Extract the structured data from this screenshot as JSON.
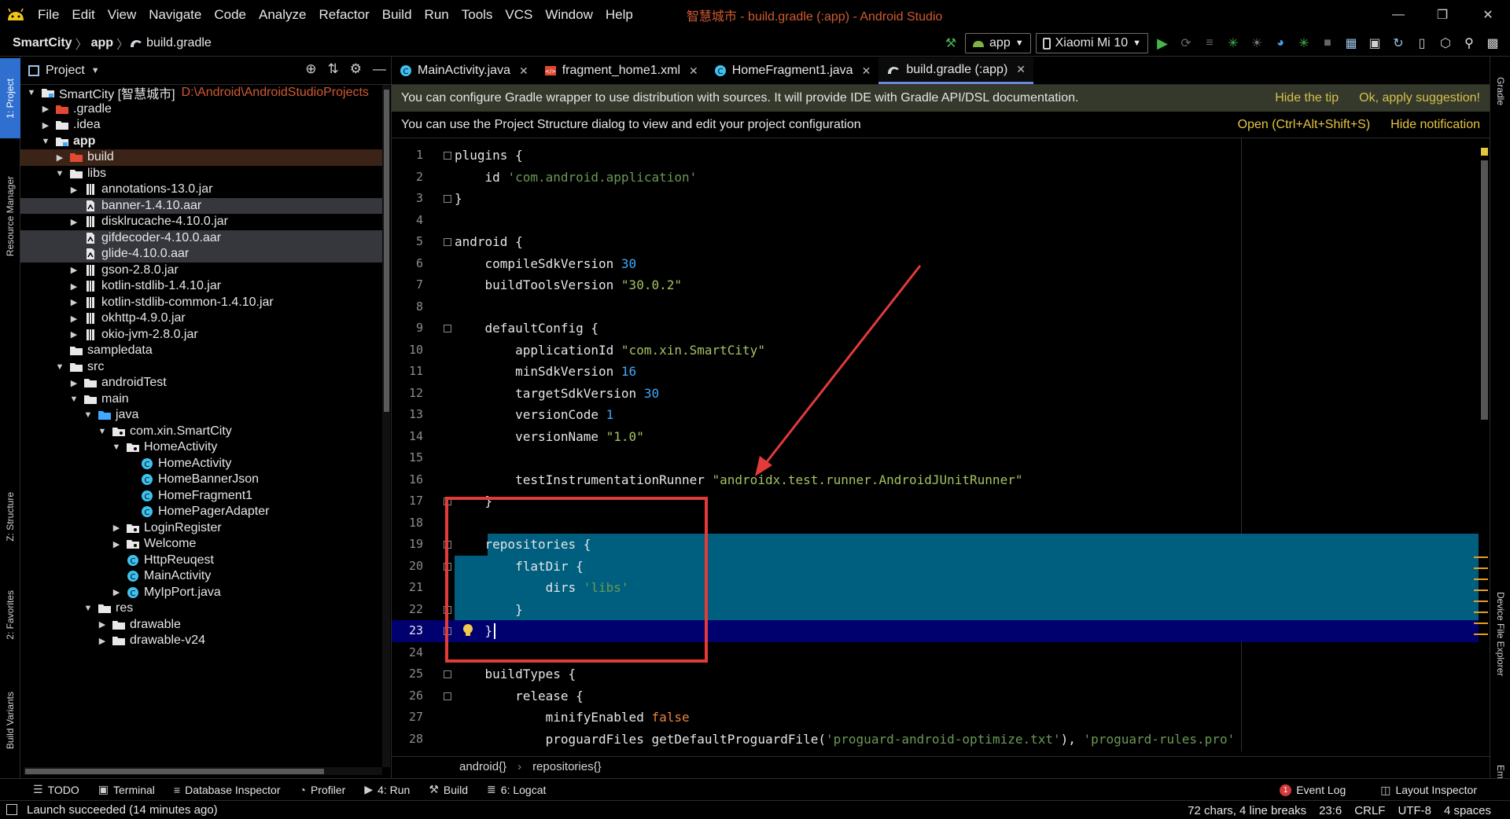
{
  "window": {
    "title": "智慧城市 - build.gradle (:app) - Android Studio",
    "menu": [
      "File",
      "Edit",
      "View",
      "Navigate",
      "Code",
      "Analyze",
      "Refactor",
      "Build",
      "Run",
      "Tools",
      "VCS",
      "Window",
      "Help"
    ]
  },
  "nav": {
    "crumbs": [
      "SmartCity",
      "app",
      "build.gradle"
    ],
    "run_config": "app",
    "device": "Xiaomi Mi 10"
  },
  "left_strip": {
    "tabs": [
      "1: Project",
      "Resource Manager",
      "Z: Structure",
      "2: Favorites",
      "Build Variants"
    ]
  },
  "right_strip": {
    "tabs": [
      "Gradle",
      "Device File Explorer",
      "Emulator"
    ]
  },
  "project": {
    "header": "Project",
    "tree": [
      {
        "label": "SmartCity [智慧城市]",
        "path": "D:\\Android\\AndroidStudioProjects",
        "depth": 0,
        "arrow": "open",
        "icon": "module"
      },
      {
        "label": ".gradle",
        "depth": 1,
        "arrow": "closed",
        "icon": "folder-orange"
      },
      {
        "label": ".idea",
        "depth": 1,
        "arrow": "closed",
        "icon": "folder"
      },
      {
        "label": "app",
        "depth": 1,
        "arrow": "open",
        "icon": "module",
        "bold": true
      },
      {
        "label": "build",
        "depth": 2,
        "arrow": "closed",
        "icon": "folder-orange",
        "state": "build"
      },
      {
        "label": "libs",
        "depth": 2,
        "arrow": "open",
        "icon": "folder"
      },
      {
        "label": "annotations-13.0.jar",
        "depth": 3,
        "arrow": "closed",
        "icon": "jar"
      },
      {
        "label": "banner-1.4.10.aar",
        "depth": 3,
        "arrow": "",
        "icon": "file",
        "state": "sel"
      },
      {
        "label": "disklrucache-4.10.0.jar",
        "depth": 3,
        "arrow": "closed",
        "icon": "jar"
      },
      {
        "label": "gifdecoder-4.10.0.aar",
        "depth": 3,
        "arrow": "",
        "icon": "file",
        "state": "sel"
      },
      {
        "label": "glide-4.10.0.aar",
        "depth": 3,
        "arrow": "",
        "icon": "file",
        "state": "sel"
      },
      {
        "label": "gson-2.8.0.jar",
        "depth": 3,
        "arrow": "closed",
        "icon": "jar"
      },
      {
        "label": "kotlin-stdlib-1.4.10.jar",
        "depth": 3,
        "arrow": "closed",
        "icon": "jar"
      },
      {
        "label": "kotlin-stdlib-common-1.4.10.jar",
        "depth": 3,
        "arrow": "closed",
        "icon": "jar"
      },
      {
        "label": "okhttp-4.9.0.jar",
        "depth": 3,
        "arrow": "closed",
        "icon": "jar"
      },
      {
        "label": "okio-jvm-2.8.0.jar",
        "depth": 3,
        "arrow": "closed",
        "icon": "jar"
      },
      {
        "label": "sampledata",
        "depth": 2,
        "arrow": "",
        "icon": "folder"
      },
      {
        "label": "src",
        "depth": 2,
        "arrow": "open",
        "icon": "folder"
      },
      {
        "label": "androidTest",
        "depth": 3,
        "arrow": "closed",
        "icon": "folder"
      },
      {
        "label": "main",
        "depth": 3,
        "arrow": "open",
        "icon": "folder"
      },
      {
        "label": "java",
        "depth": 4,
        "arrow": "open",
        "icon": "folder-blue"
      },
      {
        "label": "com.xin.SmartCity",
        "depth": 5,
        "arrow": "open",
        "icon": "package"
      },
      {
        "label": "HomeActivity",
        "depth": 6,
        "arrow": "open",
        "icon": "package"
      },
      {
        "label": "HomeActivity",
        "depth": 7,
        "arrow": "",
        "icon": "class"
      },
      {
        "label": "HomeBannerJson",
        "depth": 7,
        "arrow": "",
        "icon": "class"
      },
      {
        "label": "HomeFragment1",
        "depth": 7,
        "arrow": "",
        "icon": "class"
      },
      {
        "label": "HomePagerAdapter",
        "depth": 7,
        "arrow": "",
        "icon": "class"
      },
      {
        "label": "LoginRegister",
        "depth": 6,
        "arrow": "closed",
        "icon": "package"
      },
      {
        "label": "Welcome",
        "depth": 6,
        "arrow": "closed",
        "icon": "package"
      },
      {
        "label": "HttpReuqest",
        "depth": 6,
        "arrow": "",
        "icon": "class"
      },
      {
        "label": "MainActivity",
        "depth": 6,
        "arrow": "",
        "icon": "class"
      },
      {
        "label": "MyIpPort.java",
        "depth": 6,
        "arrow": "closed",
        "icon": "class"
      },
      {
        "label": "res",
        "depth": 4,
        "arrow": "open",
        "icon": "folder"
      },
      {
        "label": "drawable",
        "depth": 5,
        "arrow": "closed",
        "icon": "folder"
      },
      {
        "label": "drawable-v24",
        "depth": 5,
        "arrow": "closed",
        "icon": "folder"
      }
    ]
  },
  "tabs": [
    {
      "label": "MainActivity.java",
      "icon": "class"
    },
    {
      "label": "fragment_home1.xml",
      "icon": "xml"
    },
    {
      "label": "HomeFragment1.java",
      "icon": "class"
    },
    {
      "label": "build.gradle (:app)",
      "icon": "gradle",
      "active": true
    }
  ],
  "notices": [
    {
      "text": "You can configure Gradle wrapper to use distribution with sources. It will provide IDE with Gradle API/DSL documentation.",
      "actions": [
        "Hide the tip",
        "Ok, apply suggestion!"
      ]
    },
    {
      "text": "You can use the Project Structure dialog to view and edit your project configuration",
      "actions": [
        "Open (Ctrl+Alt+Shift+S)",
        "Hide notification"
      ]
    }
  ],
  "code": [
    [
      {
        "t": "plugins {",
        "c": "kw"
      }
    ],
    [
      {
        "t": "    id ",
        "c": "kw"
      },
      {
        "t": "'com.android.application'",
        "c": "str"
      }
    ],
    [
      {
        "t": "}",
        "c": "kw"
      }
    ],
    [],
    [
      {
        "t": "android {",
        "c": "kw"
      }
    ],
    [
      {
        "t": "    compileSdkVersion ",
        "c": "kw"
      },
      {
        "t": "30",
        "c": "num"
      }
    ],
    [
      {
        "t": "    buildToolsVersion ",
        "c": "kw"
      },
      {
        "t": "\"30.0.2\"",
        "c": "str2"
      }
    ],
    [],
    [
      {
        "t": "    defaultConfig {",
        "c": "kw"
      }
    ],
    [
      {
        "t": "        applicationId ",
        "c": "kw"
      },
      {
        "t": "\"com.xin.SmartCity\"",
        "c": "str2"
      }
    ],
    [
      {
        "t": "        minSdkVersion ",
        "c": "kw"
      },
      {
        "t": "16",
        "c": "num"
      }
    ],
    [
      {
        "t": "        targetSdkVersion ",
        "c": "kw"
      },
      {
        "t": "30",
        "c": "num"
      }
    ],
    [
      {
        "t": "        versionCode ",
        "c": "kw"
      },
      {
        "t": "1",
        "c": "num"
      }
    ],
    [
      {
        "t": "        versionName ",
        "c": "kw"
      },
      {
        "t": "\"1.0\"",
        "c": "str2"
      }
    ],
    [],
    [
      {
        "t": "        testInstrumentationRunner ",
        "c": "kw"
      },
      {
        "t": "\"androidx.test.runner.AndroidJUnitRunner\"",
        "c": "str2"
      }
    ],
    [
      {
        "t": "    }",
        "c": "kw"
      }
    ],
    [],
    [
      {
        "t": "    repositories {",
        "c": "kw"
      }
    ],
    [
      {
        "t": "        flatDir {",
        "c": "kw"
      }
    ],
    [
      {
        "t": "            dirs ",
        "c": "kw"
      },
      {
        "t": "'libs'",
        "c": "str"
      }
    ],
    [
      {
        "t": "        }",
        "c": "kw"
      }
    ],
    [
      {
        "t": "    }",
        "c": "kw"
      }
    ],
    [],
    [
      {
        "t": "    buildTypes {",
        "c": "kw"
      }
    ],
    [
      {
        "t": "        release {",
        "c": "kw"
      }
    ],
    [
      {
        "t": "            minifyEnabled ",
        "c": "kw"
      },
      {
        "t": "false",
        "c": "bool"
      }
    ],
    [
      {
        "t": "            proguardFiles getDefaultProguardFile(",
        "c": "kw"
      },
      {
        "t": "'proguard-android-optimize.txt'",
        "c": "str"
      },
      {
        "t": "), ",
        "c": "kw"
      },
      {
        "t": "'proguard-rules.pro'",
        "c": "str"
      }
    ]
  ],
  "current_line": 23,
  "code_breadcrumb": [
    "android{}",
    "repositories{}"
  ],
  "bottom_tools": [
    {
      "label": "TODO",
      "icon": "list-icon"
    },
    {
      "label": "Terminal",
      "icon": "terminal-icon"
    },
    {
      "label": "Database Inspector",
      "icon": "database-icon"
    },
    {
      "label": "Profiler",
      "icon": "profiler-icon"
    },
    {
      "label": "4: Run",
      "icon": "play-icon"
    },
    {
      "label": "Build",
      "icon": "hammer-icon"
    },
    {
      "label": "6: Logcat",
      "icon": "logcat-icon"
    }
  ],
  "bottom_right": {
    "event_log": "Event Log",
    "event_count": "1",
    "layout_inspector": "Layout Inspector"
  },
  "status": {
    "message": "Launch succeeded (14 minutes ago)",
    "chars": "72 chars, 4 line breaks",
    "position": "23:6",
    "line_sep": "CRLF",
    "encoding": "UTF-8",
    "indent": "4 spaces"
  }
}
